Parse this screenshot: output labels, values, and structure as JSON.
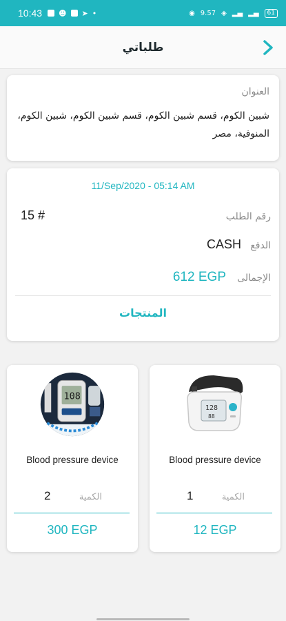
{
  "status_bar": {
    "time": "10:43",
    "net_speed": "9.57",
    "battery": "61"
  },
  "header": {
    "title": "طلباتي",
    "back_icon": "chevron-right-icon"
  },
  "address": {
    "label": "العنوان",
    "value": "شبين الكوم، قسم شبين الكوم، قسم شبين الكوم، شبين الكوم، المنوفية، مصر"
  },
  "order": {
    "date": "11/Sep/2020 - 05:14 AM",
    "number_label": "رقم الطلب",
    "number_value": "15 #",
    "payment_label": "الدفع",
    "payment_value": "CASH",
    "total_label": "الإجمالى",
    "total_value": "612 EGP",
    "products_link": "المنتجات"
  },
  "products": [
    {
      "name": "Blood pressure device",
      "qty_label": "الكمية",
      "qty": "1",
      "price": "12 EGP",
      "icon": "blood-pressure-monitor-image"
    },
    {
      "name": "Blood pressure device",
      "qty_label": "الكمية",
      "qty": "2",
      "price": "300 EGP",
      "icon": "glucose-meter-image"
    }
  ],
  "colors": {
    "accent": "#20b6c0",
    "status_bar": "#20b6c0"
  }
}
